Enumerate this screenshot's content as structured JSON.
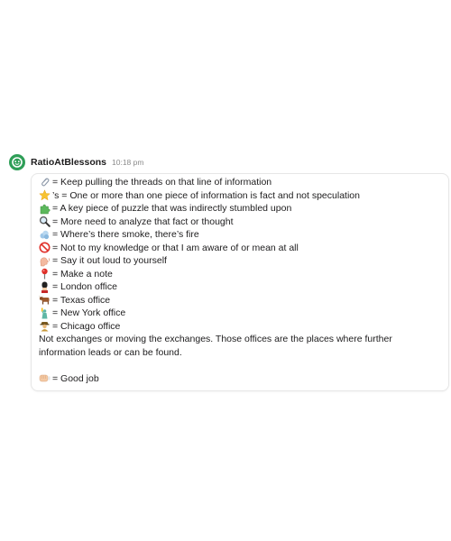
{
  "message": {
    "username": "RatioAtBlessons",
    "timestamp": "10:18 pm",
    "legend": [
      {
        "icon": "paperclip-icon",
        "text": "= Keep pulling the threads on that line of information"
      },
      {
        "icon": "star-icon",
        "text": "’s = One or more than one piece of information is fact and not speculation"
      },
      {
        "icon": "puzzle-piece-icon",
        "text": " = A key piece of puzzle that was indirectly stumbled upon"
      },
      {
        "icon": "magnifying-glass-icon",
        "text": " = More need to analyze that fact or thought"
      },
      {
        "icon": "smoke-icon",
        "text": "= Where’s there smoke, there’s fire"
      },
      {
        "icon": "prohibited-icon",
        "text": "= Not to my knowledge or that I am aware of or mean at all"
      },
      {
        "icon": "speaking-head-icon",
        "text": "= Say it out loud to yourself"
      },
      {
        "icon": "pushpin-icon",
        "text": "= Make a note"
      },
      {
        "icon": "royal-guard-icon",
        "text": "= London office"
      },
      {
        "icon": "ox-icon",
        "text": " = Texas office"
      },
      {
        "icon": "statue-of-liberty-icon",
        "text": "= New York office"
      },
      {
        "icon": "gangster-icon",
        "text": " = Chicago office"
      }
    ],
    "note": "Not exchanges or moving the exchanges. Those offices are the places where further information leads or can be found.",
    "closing": {
      "icon": "fist-bump-icon",
      "text": "= Good job"
    }
  },
  "colors": {
    "avatar_bg": "#2e9e57",
    "border": "#e6e6e6",
    "text": "#1d1c1d",
    "muted": "#8a8a8a"
  }
}
